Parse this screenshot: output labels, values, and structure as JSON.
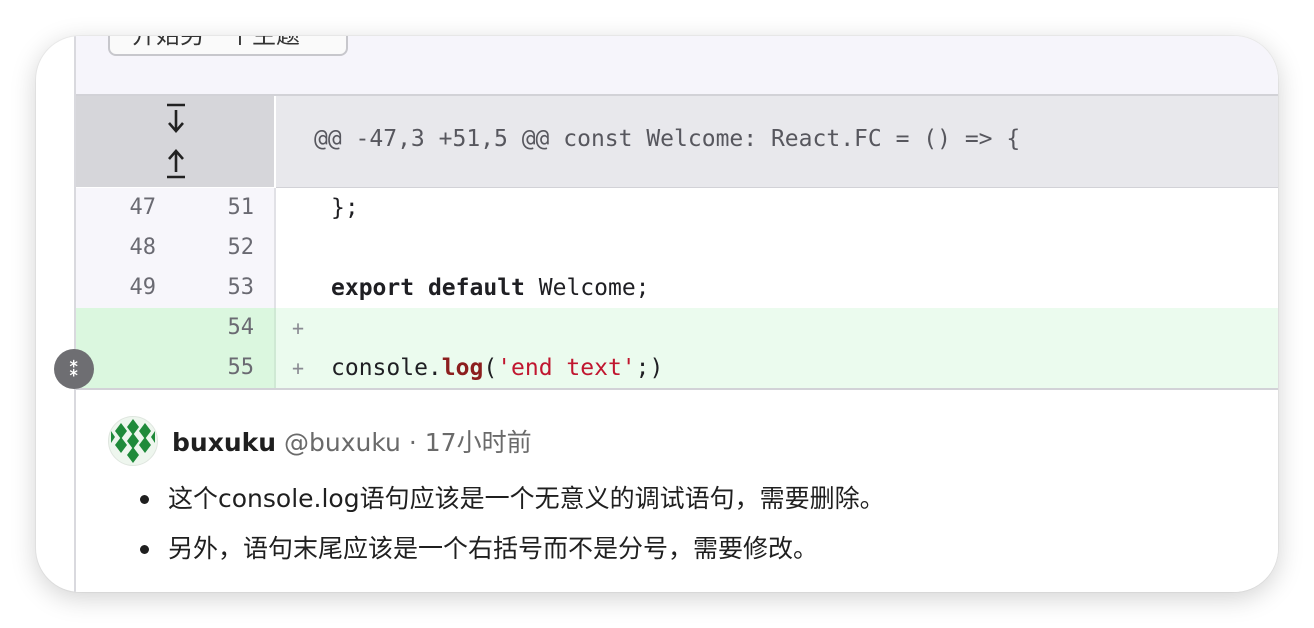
{
  "thread_button": {
    "label": "开始另一个主题"
  },
  "hunk": {
    "header": "@@ -47,3 +51,5 @@ const Welcome: React.FC = () => {"
  },
  "diff_lines": [
    {
      "old": "47",
      "new": "51",
      "marker": "",
      "code": "};"
    },
    {
      "old": "48",
      "new": "52",
      "marker": "",
      "code": ""
    },
    {
      "old": "49",
      "new": "53",
      "marker": "",
      "code_tokens": [
        "export",
        "default",
        "Welcome;"
      ]
    },
    {
      "old": "",
      "new": "54",
      "marker": "+",
      "code": ""
    },
    {
      "old": "",
      "new": "55",
      "marker": "+",
      "code_tokens": [
        "console.",
        "log",
        "(",
        "'end text'",
        ";)"
      ]
    }
  ],
  "comment_toggle": {
    "icon": "collapse-icon"
  },
  "comment": {
    "username": "buxuku",
    "handle": "@buxuku",
    "separator": "·",
    "time": "17小时前",
    "bullets": [
      "这个console.log语句应该是一个无意义的调试语句，需要删除。",
      "另外，语句末尾应该是一个右括号而不是分号，需要修改。"
    ]
  },
  "colors": {
    "added_bg": "#ebfbee",
    "added_gutter": "#dbf7df",
    "hunk_bg": "#e8e8ec",
    "keyword_fn": "#8c1e1e",
    "string": "#c0162f"
  }
}
